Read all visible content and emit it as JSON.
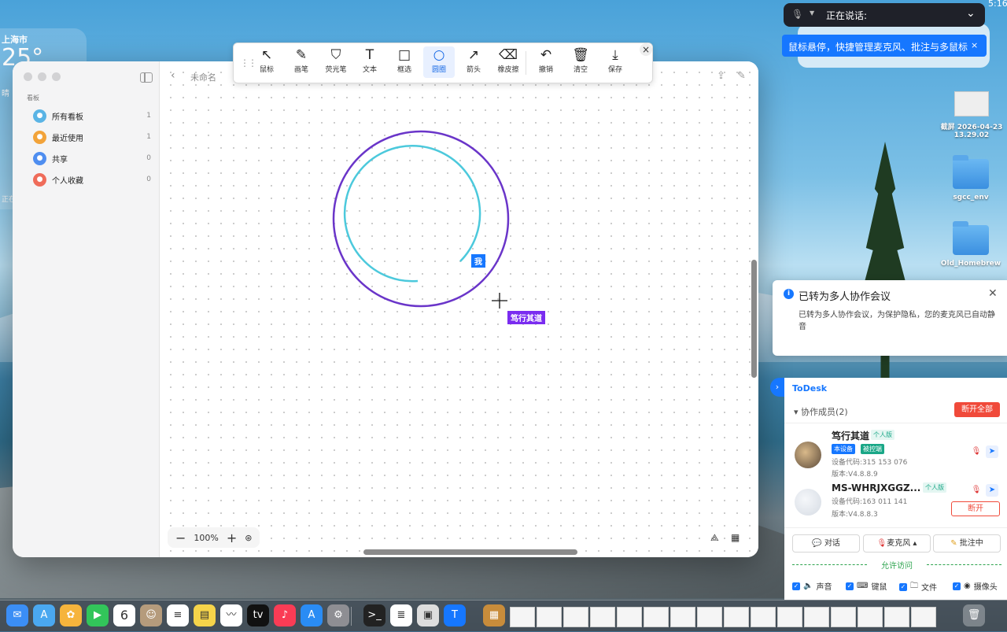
{
  "menubar": {
    "time": "5:16"
  },
  "weather": {
    "city": "上海市",
    "temp": "25°",
    "condition": "晴",
    "note": "正在此"
  },
  "window": {
    "doc_title": "未命名",
    "sidebar": {
      "section_title": "看板",
      "items": [
        {
          "label": "所有看板",
          "count": "1",
          "color": "#5ab4e5",
          "icon": "boards-icon"
        },
        {
          "label": "最近使用",
          "count": "1",
          "color": "#f2a33a",
          "icon": "clock-icon"
        },
        {
          "label": "共享",
          "count": "0",
          "color": "#4f8ef0",
          "icon": "people-icon"
        },
        {
          "label": "个人收藏",
          "count": "0",
          "color": "#ef6c5a",
          "icon": "heart-icon"
        }
      ]
    },
    "zoom": "100%"
  },
  "annotation_toolbar": {
    "tools": [
      {
        "label": "鼠标",
        "icon": "cursor-icon",
        "glyph": "↖"
      },
      {
        "label": "画笔",
        "icon": "pen-icon",
        "glyph": "✎"
      },
      {
        "label": "荧光笔",
        "icon": "highlighter-icon",
        "glyph": "⛉"
      },
      {
        "label": "文本",
        "icon": "text-icon",
        "glyph": "T"
      },
      {
        "label": "框选",
        "icon": "rectangle-icon",
        "glyph": "□"
      },
      {
        "label": "圆圈",
        "icon": "circle-icon",
        "glyph": "○",
        "active": true
      },
      {
        "label": "箭头",
        "icon": "arrow-icon",
        "glyph": "↗"
      },
      {
        "label": "橡皮擦",
        "icon": "eraser-icon",
        "glyph": "⌫"
      },
      {
        "label": "撤销",
        "icon": "undo-icon",
        "glyph": "↶"
      },
      {
        "label": "清空",
        "icon": "trash-icon",
        "glyph": "🗑"
      },
      {
        "label": "保存",
        "icon": "download-icon",
        "glyph": "⤓"
      }
    ]
  },
  "canvas_annotations": {
    "me_tag": "我",
    "peer_tag": "笃行其道",
    "outer_circle_color": "#6a35c9",
    "inner_circle_color": "#4cc9dc"
  },
  "speaking_bar": {
    "label": "正在说话:"
  },
  "tooltip": {
    "text": "鼠标悬停，快捷管理麦克风、批注与多鼠标"
  },
  "desktop_icons": [
    {
      "label": "截屏 2026-04-23 13.29.02",
      "type": "thumbnail"
    },
    {
      "label": "sgcc_env",
      "type": "folder"
    },
    {
      "label": "Old_Homebrew",
      "type": "folder"
    }
  ],
  "notification": {
    "title": "已转为多人协作会议",
    "body": "已转为多人协作会议，为保护隐私，您的麦克风已自动静音"
  },
  "todesk": {
    "brand": "ToDesk",
    "members_label": "协作成员(2)",
    "disconnect_all": "断开全部",
    "members": [
      {
        "name": "笃行其道",
        "edition": "个人版",
        "tags": [
          "本设备",
          "被控端"
        ],
        "code": "设备代码:315 153 076",
        "version": "版本:V4.8.8.9"
      },
      {
        "name": "MS-WHRJXGGZ...",
        "edition": "个人版",
        "code": "设备代码:163 011 141",
        "version": "版本:V4.8.8.3",
        "action": "断开"
      }
    ],
    "actions": [
      "对话",
      "麦克风",
      "批注中"
    ],
    "allow_label": "允许访问",
    "permissions": [
      "声音",
      "键鼠",
      "文件",
      "摄像头"
    ]
  },
  "dock": {
    "calendar_day": "6",
    "apps": [
      {
        "name": "mail-icon",
        "color": "#3b8ef5",
        "glyph": "✉"
      },
      {
        "name": "maps-icon",
        "color": "#4aa8f0",
        "glyph": "A"
      },
      {
        "name": "photos-icon",
        "color": "#f6b43c",
        "glyph": "✿"
      },
      {
        "name": "facetime-icon",
        "color": "#32c55a",
        "glyph": "▶"
      },
      {
        "name": "calendar-icon",
        "color": "#ffffff",
        "glyph": ""
      },
      {
        "name": "contacts-icon",
        "color": "#b59b7c",
        "glyph": "☺"
      },
      {
        "name": "reminders-icon",
        "color": "#ffffff",
        "glyph": "≡"
      },
      {
        "name": "notes-icon",
        "color": "#f6d44a",
        "glyph": "▤"
      },
      {
        "name": "freeform-icon",
        "color": "#ffffff",
        "glyph": "〰"
      },
      {
        "name": "tv-icon",
        "color": "#111111",
        "glyph": "tv"
      },
      {
        "name": "music-icon",
        "color": "#fa3c55",
        "glyph": "♪"
      },
      {
        "name": "appstore-icon",
        "color": "#2a8cf4",
        "glyph": "A"
      },
      {
        "name": "settings-icon",
        "color": "#8e8e93",
        "glyph": "⚙"
      },
      {
        "name": "terminal-icon",
        "color": "#222222",
        "glyph": ">_"
      },
      {
        "name": "textedit-icon",
        "color": "#ffffff",
        "glyph": "≣"
      },
      {
        "name": "preview-icon",
        "color": "#dddddd",
        "glyph": "▣"
      },
      {
        "name": "todesk-icon",
        "color": "#1677ff",
        "glyph": "T"
      }
    ]
  }
}
